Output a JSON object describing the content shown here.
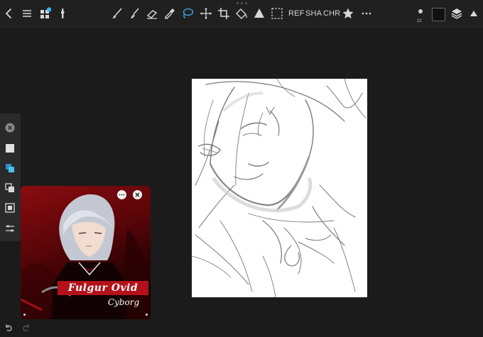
{
  "toolbar": {
    "left_icons": [
      "back-icon",
      "menu-icon",
      "gallery-icon",
      "adjustments-icon"
    ],
    "tools": [
      "brush-icon",
      "smudge-icon",
      "eraser-icon",
      "eyedropper-icon",
      "lasso-icon",
      "move-icon",
      "crop-icon",
      "fill-icon",
      "shape-icon",
      "selection-icon"
    ],
    "text_buttons": {
      "ref": "REF",
      "sha": "SHA",
      "chr": "CHR"
    },
    "brush_size": "22",
    "current_color": "#111111",
    "accent": "#3aa0d8",
    "notification_color": "#3ab4f2"
  },
  "sidebar": {
    "items": [
      "close-icon",
      "square-icon",
      "layers-blue-icon",
      "copy-icon",
      "merge-icon",
      "sliders-icon"
    ]
  },
  "reference": {
    "title": "Fulgur Ovid",
    "subtitle": "Cyborg"
  }
}
